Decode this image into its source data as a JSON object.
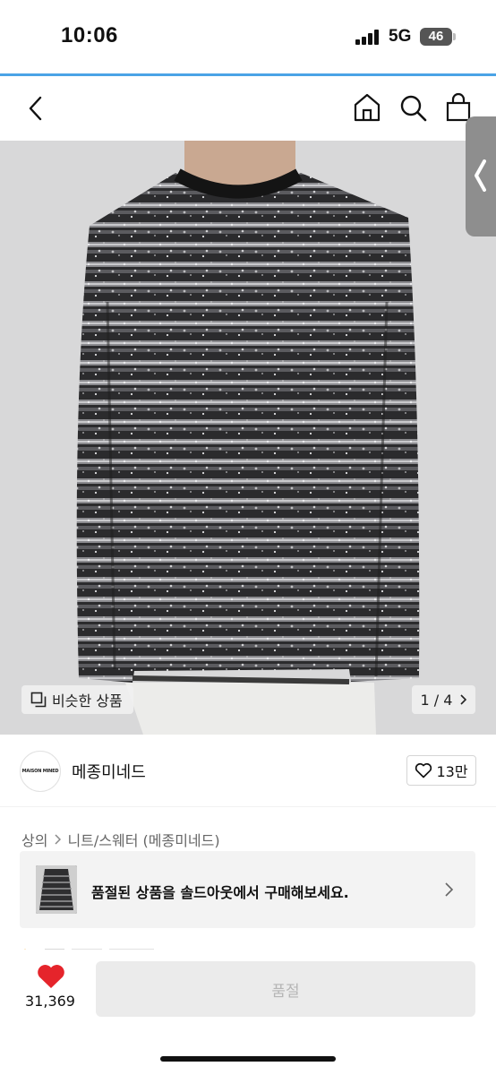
{
  "status": {
    "time": "10:06",
    "network": "5G",
    "battery": "46"
  },
  "colors": {
    "accent": "#4aa3e6",
    "heart": "#e5242b",
    "disabled_button": "#ebebeb"
  },
  "nav": {
    "icons": [
      "chevron-left-icon",
      "home-icon",
      "search-icon",
      "shopping-bag-icon"
    ]
  },
  "gallery": {
    "similar_label": "비슷한 상품",
    "counter": "1 / 4"
  },
  "brand": {
    "logo_text": "MAISON MINED",
    "name": "메종미네드",
    "likes": "13만"
  },
  "breadcrumb": {
    "items": [
      "상의",
      "니트/스웨터 (메종미네드)"
    ]
  },
  "soldout": {
    "message": "품절된 상품을 솔드아웃에서 구매해보세요."
  },
  "bottom": {
    "likes": "31,369",
    "button_label": "품절"
  }
}
